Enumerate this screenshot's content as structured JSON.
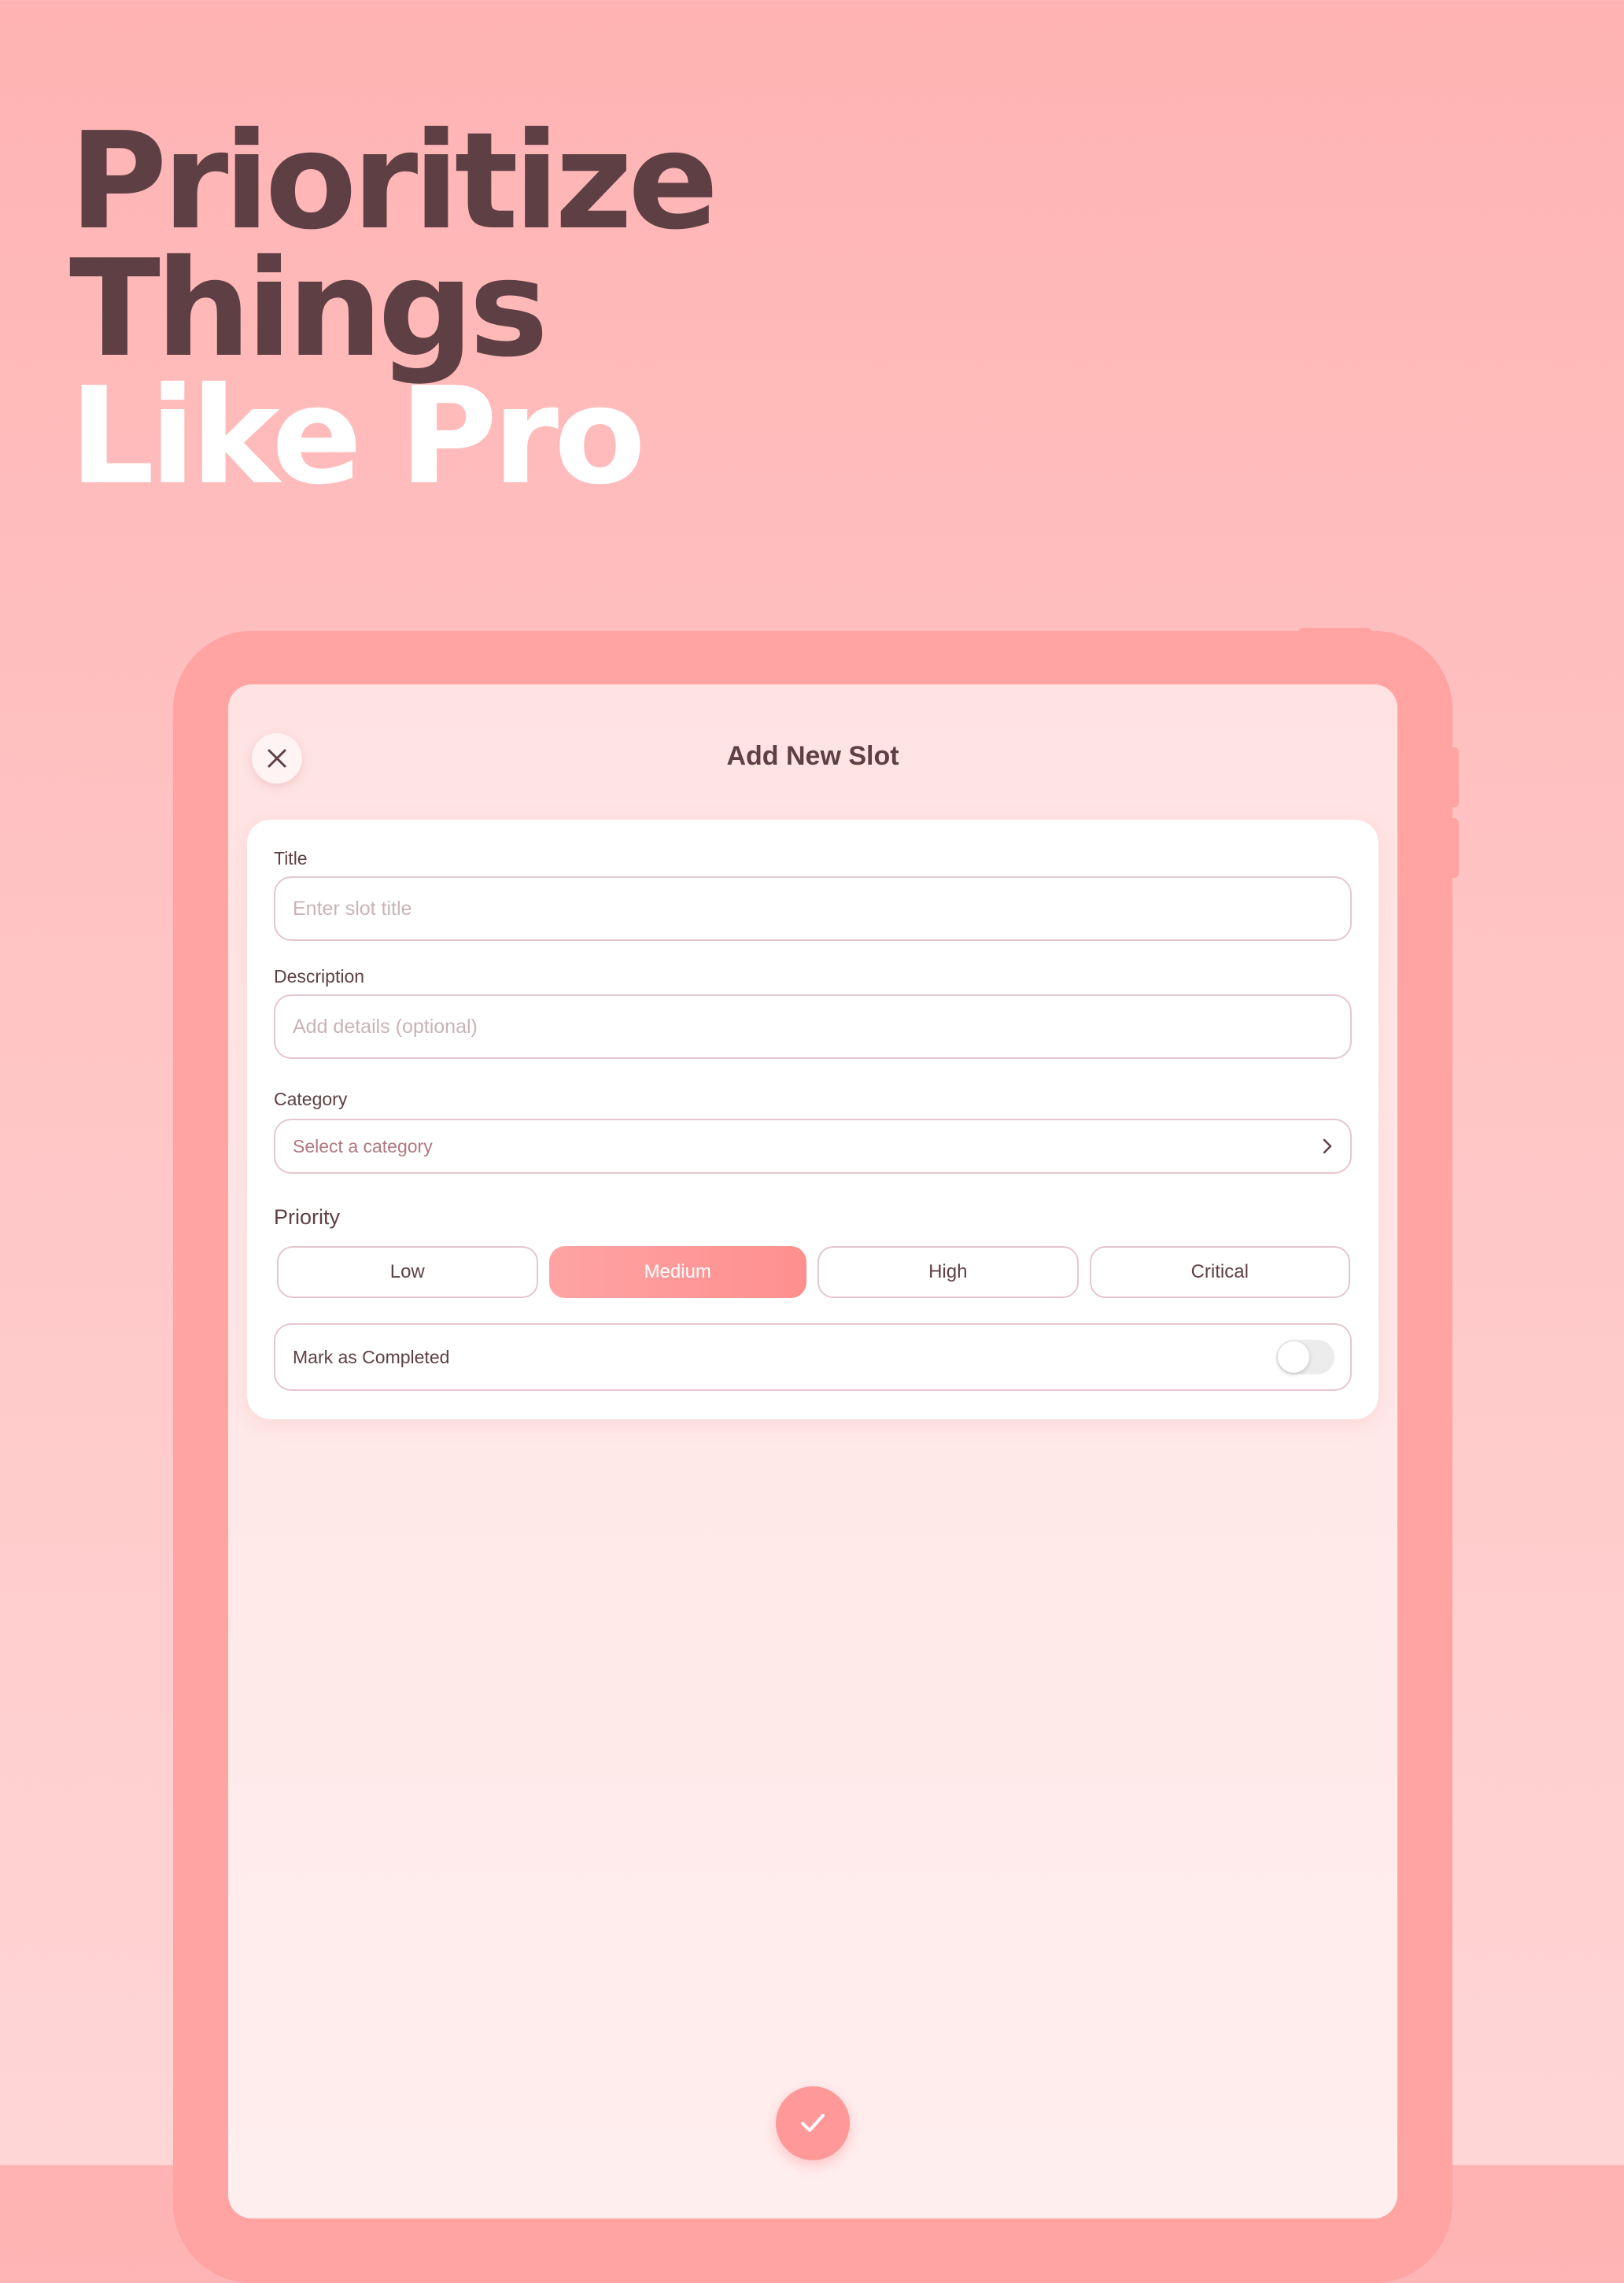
{
  "headline": {
    "line1": "Prioritize",
    "line2": "Things",
    "line3": "Like Pro"
  },
  "sheet": {
    "title": "Add New Slot",
    "close_icon": "close-icon",
    "confirm_icon": "checkmark-icon"
  },
  "form": {
    "title": {
      "label": "Title",
      "value": "",
      "placeholder": "Enter slot title"
    },
    "description": {
      "label": "Description",
      "value": "",
      "placeholder": "Add details (optional)"
    },
    "category": {
      "label": "Category",
      "value": "Select a category",
      "icon": "chevron-right-icon"
    },
    "priority": {
      "label": "Priority",
      "options": [
        "Low",
        "Medium",
        "High",
        "Critical"
      ],
      "selected": "Medium"
    },
    "completed": {
      "label": "Mark as Completed",
      "on": false
    }
  },
  "colors": {
    "background": "#ffb3b3",
    "device_frame": "#ffa3a3",
    "accent": "#ff9999",
    "headline_dark": "#5e4044",
    "headline_light": "#ffffff",
    "text_primary": "#5e4044",
    "input_border": "#e4c7cd"
  }
}
